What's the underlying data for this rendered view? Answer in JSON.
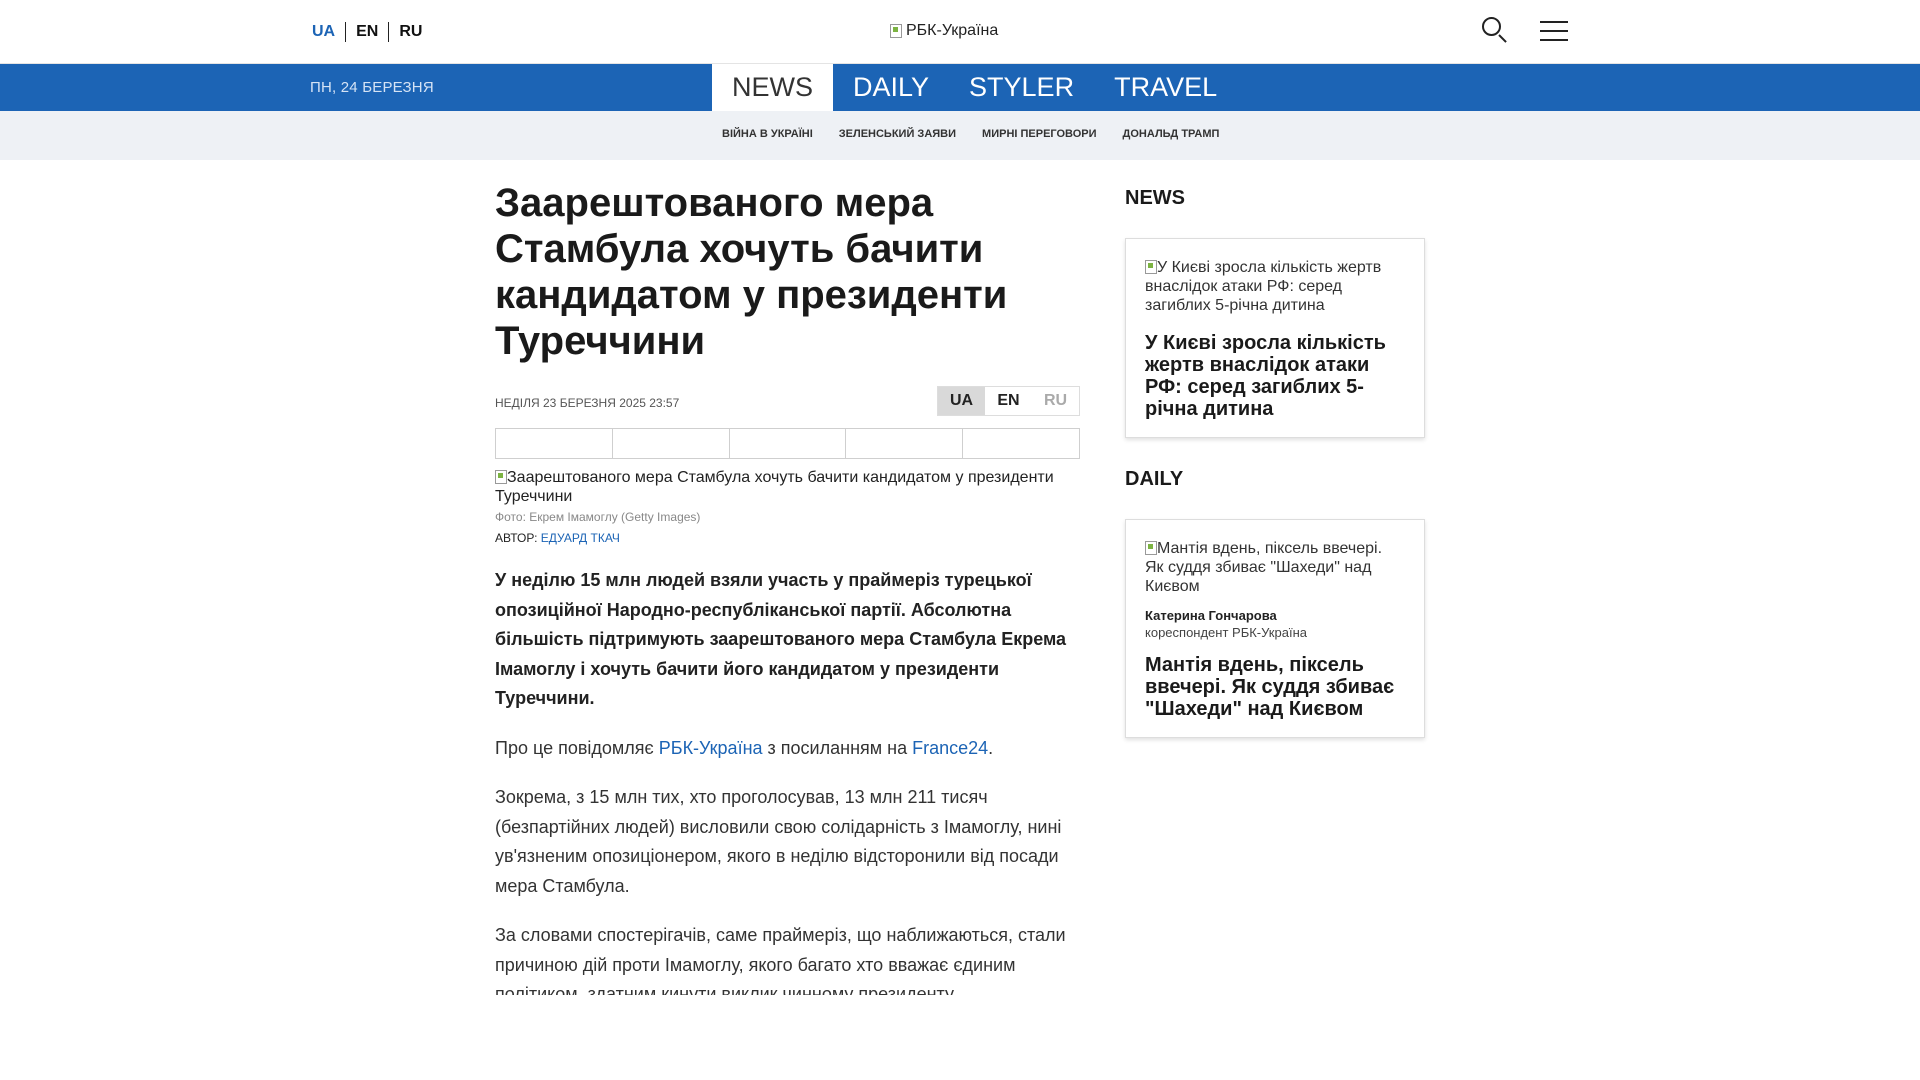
{
  "header": {
    "languages": [
      "UA",
      "EN",
      "RU"
    ],
    "logo_alt": "РБК-Україна"
  },
  "nav": {
    "date": "ПН, 24 БЕРЕЗНЯ",
    "sections": [
      "NEWS",
      "DAILY",
      "STYLER",
      "TRAVEL"
    ],
    "active_section": "NEWS"
  },
  "tags": [
    "ВІЙНА В УКРАЇНІ",
    "ЗЕЛЕНСЬКИЙ ЗАЯВИ",
    "МИРНІ ПЕРЕГОВОРИ",
    "ДОНАЛЬД ТРАМП"
  ],
  "article": {
    "title": "Заарештованого мера Стамбула хочуть бачити кандидатом у президенти Туреччини",
    "date": "НЕДІЛЯ 23 БЕРЕЗНЯ 2025 23:57",
    "languages": [
      "UA",
      "EN",
      "RU"
    ],
    "image_alt": "Заарештованого мера Стамбула хочуть бачити кандидатом у президенти Туреччини",
    "caption": "Фото: Екрем Імамоглу (Getty Images)",
    "author_label": "АВТОР:",
    "author_name": "ЕДУАРД ТКАЧ",
    "lead": "У неділю 15 млн людей взяли участь у праймеріз турецької опозиційної Народно-республіканської партії. Абсолютна більшість підтримують заарештованого мера Стамбула Екрема Імамоглу і хочуть бачити його кандидатом у президенти Туреччини.",
    "source_intro": "Про це повідомляє",
    "source_link": "РБК-Україна",
    "source_mid": "з посиланням на",
    "source_link2": "France24",
    "source_end": ".",
    "para2": "Зокрема, з 15 млн тих, хто проголосував, 13 млн 211 тисяч (безпартійних людей) висловили свою солідарність з Імамоглу, нині ув'язненим опозиціонером, якого в неділю відсторонили від посади мера Стамбула.",
    "para3": "За словами спостерігачів, саме праймеріз, що наближаються, стали причиною дій проти Імамоглу, якого багато хто вважає єдиним політиком, здатним кинути виклик чинному президенту"
  },
  "sidebar": {
    "news_heading": "NEWS",
    "news_card": {
      "image_alt": "У Києві зросла кількість жертв внаслідок атаки РФ: серед загиблих 5-річна дитина",
      "title": "У Києві зросла кількість жертв внаслідок атаки РФ: серед загиблих 5-річна дитина"
    },
    "daily_heading": "DAILY",
    "daily_card": {
      "image_alt": "Мантія вдень, піксель ввечері. Як суддя збиває \"Шахеди\" над Києвом",
      "author": "Катерина Гончарова",
      "role": "кореспондент РБК-Україна",
      "title": "Мантія вдень, піксель ввечері. Як суддя збиває \"Шахеди\" над Києвом"
    }
  },
  "colors": {
    "accent": "#1c64b5",
    "tags_bg": "#eef1f5"
  }
}
